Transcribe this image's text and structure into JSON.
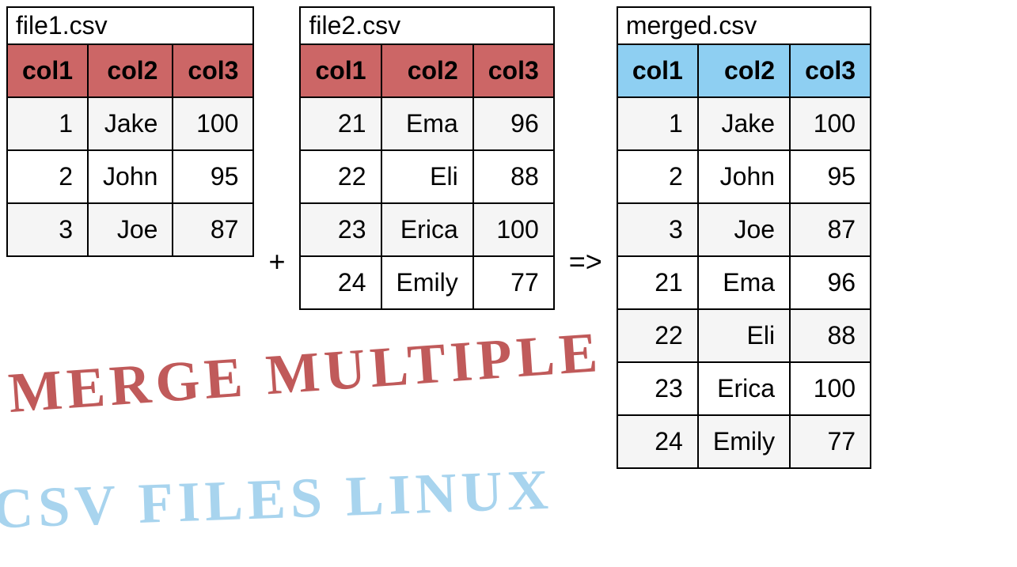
{
  "tables": [
    {
      "filename": "file1.csv",
      "headerClass": "hdr-red",
      "cols": [
        "col1",
        "col2",
        "col3"
      ],
      "rows": [
        [
          "1",
          "Jake",
          "100"
        ],
        [
          "2",
          "John",
          "95"
        ],
        [
          "3",
          "Joe",
          "87"
        ]
      ]
    },
    {
      "filename": "file2.csv",
      "headerClass": "hdr-red",
      "cols": [
        "col1",
        "col2",
        "col3"
      ],
      "rows": [
        [
          "21",
          "Ema",
          "96"
        ],
        [
          "22",
          "Eli",
          "88"
        ],
        [
          "23",
          "Erica",
          "100"
        ],
        [
          "24",
          "Emily",
          "77"
        ]
      ]
    },
    {
      "filename": "merged.csv",
      "headerClass": "hdr-blue",
      "cols": [
        "col1",
        "col2",
        "col3"
      ],
      "rows": [
        [
          "1",
          "Jake",
          "100"
        ],
        [
          "2",
          "John",
          "95"
        ],
        [
          "3",
          "Joe",
          "87"
        ],
        [
          "21",
          "Ema",
          "96"
        ],
        [
          "22",
          "Eli",
          "88"
        ],
        [
          "23",
          "Erica",
          "100"
        ],
        [
          "24",
          "Emily",
          "77"
        ]
      ]
    }
  ],
  "operators": {
    "plus": "+",
    "arrow": "=>"
  },
  "caption": {
    "line1": "MERGE MULTIPLE",
    "line2": "CSV FILES LINUX"
  },
  "chart_data": {
    "type": "table",
    "title": "Merge multiple CSV files (Linux) — concatenating file1.csv and file2.csv into merged.csv",
    "inputs": [
      {
        "name": "file1.csv",
        "columns": [
          "col1",
          "col2",
          "col3"
        ],
        "rows": [
          [
            1,
            "Jake",
            100
          ],
          [
            2,
            "John",
            95
          ],
          [
            3,
            "Joe",
            87
          ]
        ]
      },
      {
        "name": "file2.csv",
        "columns": [
          "col1",
          "col2",
          "col3"
        ],
        "rows": [
          [
            21,
            "Ema",
            96
          ],
          [
            22,
            "Eli",
            88
          ],
          [
            23,
            "Erica",
            100
          ],
          [
            24,
            "Emily",
            77
          ]
        ]
      }
    ],
    "output": {
      "name": "merged.csv",
      "columns": [
        "col1",
        "col2",
        "col3"
      ],
      "rows": [
        [
          1,
          "Jake",
          100
        ],
        [
          2,
          "John",
          95
        ],
        [
          3,
          "Joe",
          87
        ],
        [
          21,
          "Ema",
          96
        ],
        [
          22,
          "Eli",
          88
        ],
        [
          23,
          "Erica",
          100
        ],
        [
          24,
          "Emily",
          77
        ]
      ]
    }
  }
}
